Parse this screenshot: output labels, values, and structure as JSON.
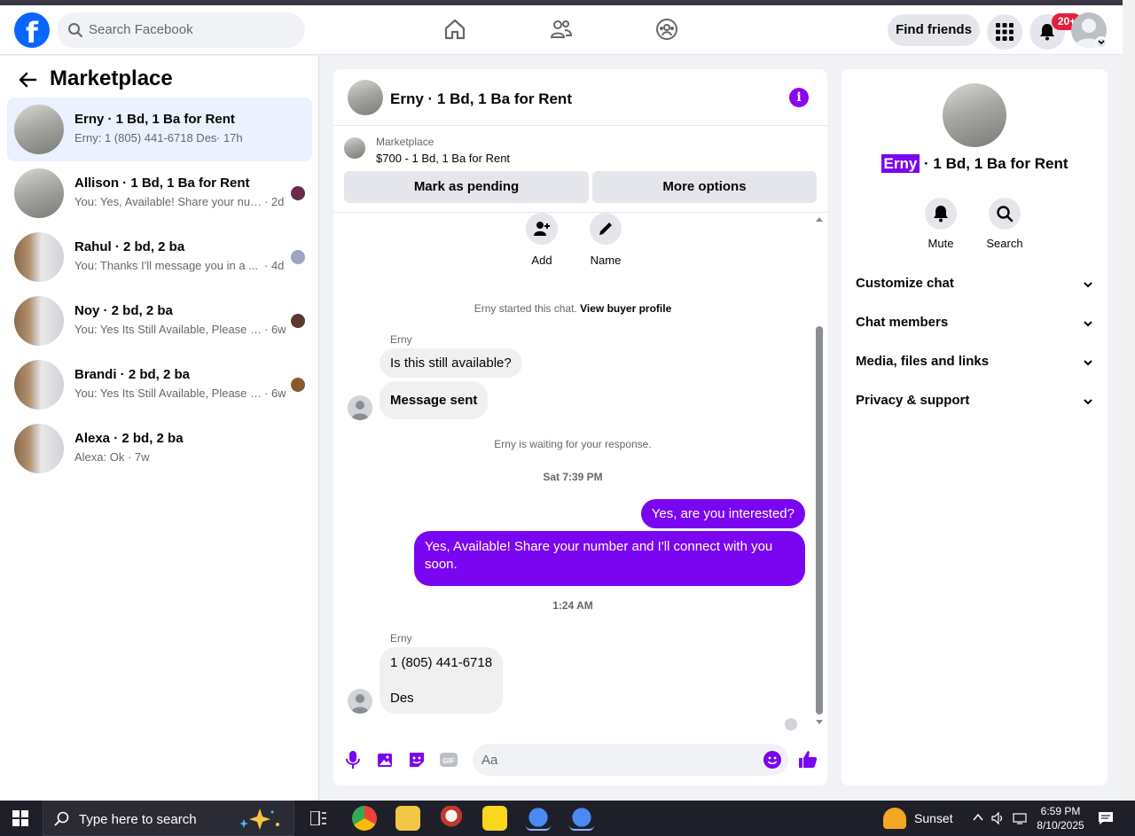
{
  "header": {
    "search_placeholder": "Search Facebook",
    "find_friends": "Find friends",
    "notification_count": "20+",
    "logo_letter": "f"
  },
  "sidebar": {
    "title": "Marketplace",
    "conversations": [
      {
        "name": "Erny · 1 Bd, 1 Ba for Rent",
        "preview": "Erny: 1 (805) 441-6718 Des",
        "time": "· 17h"
      },
      {
        "name": "Allison · 1 Bd, 1 Ba for Rent",
        "preview": "You: Yes, Available! Share your num...",
        "time": "· 2d"
      },
      {
        "name": "Rahul · 2 bd, 2 ba",
        "preview": "You: Thanks I'll message you in a ...",
        "time": "· 4d"
      },
      {
        "name": "Noy · 2 bd, 2 ba",
        "preview": "You: Yes Its Still Available, Please S...",
        "time": "· 6w"
      },
      {
        "name": "Brandi · 2 bd, 2 ba",
        "preview": "You: Yes Its Still Available, Please S...",
        "time": "· 6w"
      },
      {
        "name": "Alexa · 2 bd, 2 ba",
        "preview": "Alexa: Ok",
        "time": "· 7w"
      }
    ]
  },
  "chat": {
    "title": "Erny · 1 Bd, 1 Ba for Rent",
    "marketplace_label": "Marketplace",
    "listing": "$700 - 1 Bd, 1 Ba for Rent",
    "mark_pending": "Mark as pending",
    "more_options": "More options",
    "quick_add": "Add",
    "quick_name": "Name",
    "started_text": "Erny started this chat.",
    "view_buyer": "View buyer profile",
    "sender_name": "Erny",
    "msg_1": "Is this still available?",
    "msg_2": "Message sent",
    "waiting": "Erny is waiting for your response.",
    "time_1": "Sat 7:39 PM",
    "out_1": "Yes, are you interested?",
    "out_2": "Yes, Available! Share your number and I'll connect with you soon.",
    "time_2": "1:24 AM",
    "msg_3_line1": "1 (805) 441-6718",
    "msg_3_line2": "Des",
    "composer_placeholder": "Aa"
  },
  "info": {
    "name_highlight": "Erny",
    "name_rest": " · 1 Bd, 1 Ba for Rent",
    "mute": "Mute",
    "search": "Search",
    "sections": [
      "Customize chat",
      "Chat members",
      "Media, files and links",
      "Privacy & support"
    ]
  },
  "taskbar": {
    "search_placeholder": "Type here to search",
    "weather": "Sunset",
    "time": "6:59 PM",
    "date": "8/10/2025"
  },
  "colors": {
    "brand": "#0866ff",
    "accent": "#7a05f0",
    "badge": "#e41e3f"
  }
}
